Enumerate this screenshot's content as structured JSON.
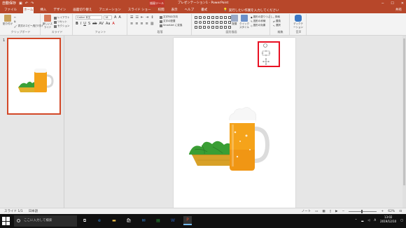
{
  "titlebar": {
    "autosave": "自動保存",
    "ctx_tab": "描画ツール",
    "title": "プレゼンテーション1 - PowerPoint",
    "qat_icons": [
      "save-icon",
      "undo-icon",
      "redo-icon"
    ]
  },
  "tabs": [
    {
      "label": "ファイル"
    },
    {
      "label": "ホーム",
      "active": true
    },
    {
      "label": "挿入"
    },
    {
      "label": "デザイン"
    },
    {
      "label": "画面切り替え"
    },
    {
      "label": "アニメーション"
    },
    {
      "label": "スライド ショー"
    },
    {
      "label": "校閲"
    },
    {
      "label": "表示"
    },
    {
      "label": "ヘルプ"
    },
    {
      "label": "書式",
      "ctx": true
    }
  ],
  "tellme": "実行したい作業を入力してください",
  "share": "共有",
  "ribbon": {
    "clipboard": {
      "paste": "貼り付け",
      "label": "クリップボード",
      "copy_format": "書式のコピー/貼り付け"
    },
    "slides": {
      "new_slide": "新しいスライド",
      "layout": "レイアウト",
      "reset": "リセット",
      "section": "セクション",
      "label": "スライド"
    },
    "font": {
      "name": "Calibri 本文",
      "size": "18",
      "label": "フォント"
    },
    "paragraph": {
      "label": "段落",
      "text_direction": "文字列の方向",
      "align_text": "文字の配置",
      "smartart": "SmartArt に変換"
    },
    "drawing": {
      "arrange": "配置",
      "quick_styles": "クイック スタイル",
      "fill": "図形の塗りつぶし",
      "outline": "図形の枠線",
      "effects": "図形の効果",
      "label": "図形描画"
    },
    "editing": {
      "find": "検索",
      "replace": "置換",
      "select": "選択",
      "label": "編集"
    },
    "voice": {
      "dictate": "ディクテーション",
      "label": "音声"
    }
  },
  "thumbnail": {
    "number": "1"
  },
  "status": {
    "slide": "スライド 1/1",
    "language": "日本語",
    "notes": "ノート",
    "zoom": "62%"
  },
  "taskbar": {
    "search_placeholder": "ここに入力して検索",
    "time": "13:02",
    "date": "2019/12/10"
  }
}
